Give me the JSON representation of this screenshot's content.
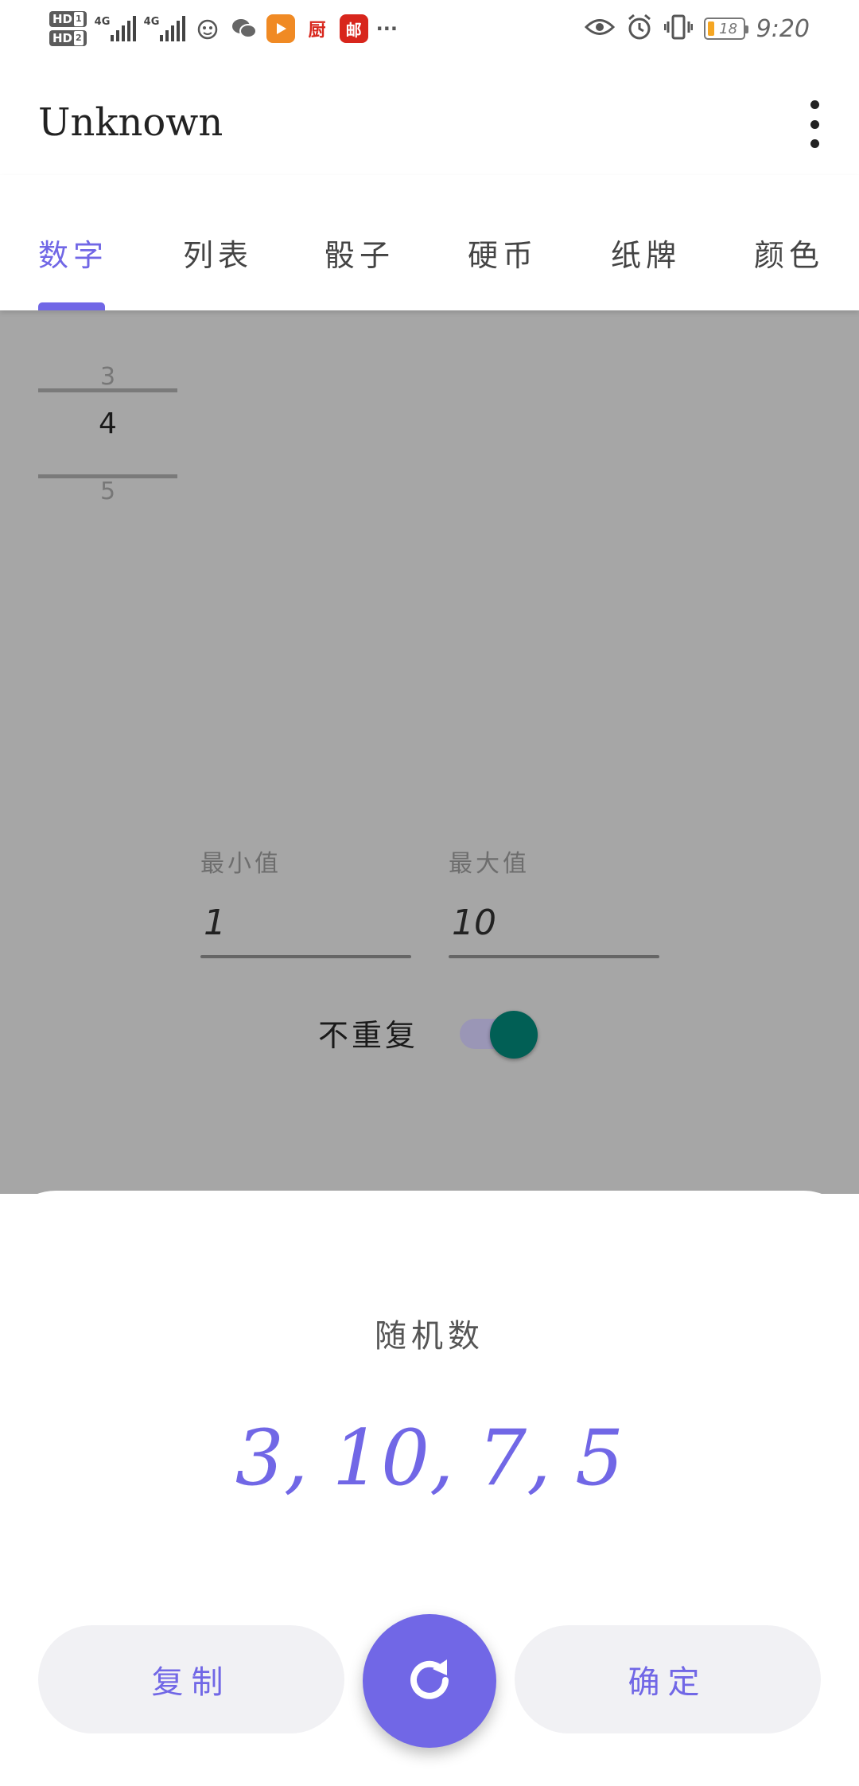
{
  "status_bar": {
    "hd1": "HD",
    "hd1_sub": "1",
    "hd2": "HD",
    "hd2_sub": "2",
    "net1": "4G",
    "net2": "4G",
    "app_icon_chuchu": "厨",
    "app_icon_you": "邮",
    "more_dots": "···",
    "battery": "18",
    "time": "9:20",
    "icons": [
      "wechat-icon",
      "video-icon",
      "eye-icon",
      "alarm-icon",
      "vibrate-icon"
    ]
  },
  "app_bar": {
    "title": "Unknown"
  },
  "tabs": {
    "items": [
      "数字",
      "列表",
      "骰子",
      "硬币",
      "纸牌",
      "颜色"
    ],
    "active_index": 0
  },
  "picker": {
    "prev": "3",
    "current": "4",
    "next": "5"
  },
  "min_field": {
    "label": "最小值",
    "value": "1"
  },
  "max_field": {
    "label": "最大值",
    "value": "10"
  },
  "no_repeat": {
    "label": "不重复",
    "checked": true
  },
  "sheet": {
    "title": "随机数",
    "result": "3, 10, 7, 5",
    "copy_label": "复制",
    "confirm_label": "确定",
    "refresh_icon": "refresh-icon"
  },
  "colors": {
    "accent": "#7167e6",
    "switch_thumb": "#015f55",
    "overlay": "#a6a6a6"
  }
}
